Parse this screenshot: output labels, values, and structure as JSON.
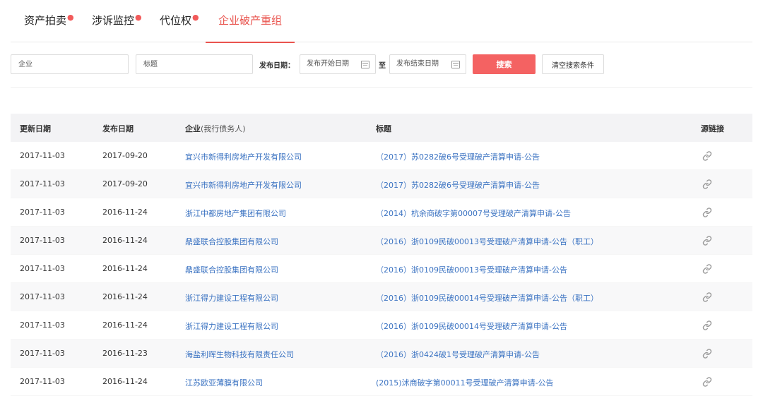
{
  "tabs": [
    {
      "label": "资产拍卖",
      "dot": "●"
    },
    {
      "label": "涉诉监控",
      "dot": "●"
    },
    {
      "label": "代位权",
      "dot": "●"
    },
    {
      "label": "企业破产重组",
      "dot": ""
    }
  ],
  "filters": {
    "company_placeholder": "企业",
    "title_placeholder": "标题",
    "date_label": "发布日期：",
    "start_placeholder": "发布开始日期",
    "to_label": "至",
    "end_placeholder": "发布结束日期",
    "search_label": "搜索",
    "clear_label": "清空搜索条件"
  },
  "table": {
    "headers": {
      "update_date": "更新日期",
      "publish_date": "发布日期",
      "company": "企业",
      "company_sub": "(我行债务人)",
      "title": "标题",
      "source": "源链接"
    },
    "rows": [
      {
        "update": "2017-11-03",
        "publish": "2017-09-20",
        "company": "宜兴市新得利房地产开发有限公司",
        "title": "（2017）苏0282破6号受理破产清算申请-公告",
        "icon": "link-icon"
      },
      {
        "update": "2017-11-03",
        "publish": "2017-09-20",
        "company": "宜兴市新得利房地产开发有限公司",
        "title": "（2017）苏0282破6号受理破产清算申请-公告",
        "icon": "link-icon"
      },
      {
        "update": "2017-11-03",
        "publish": "2016-11-24",
        "company": "浙江中都房地产集团有限公司",
        "title": "（2014）杭余商破字第00007号受理破产清算申请-公告",
        "icon": "link-icon"
      },
      {
        "update": "2017-11-03",
        "publish": "2016-11-24",
        "company": "鼎盛联合控股集团有限公司",
        "title": "（2016）浙0109民破00013号受理破产清算申请-公告（职工）",
        "icon": "link-icon"
      },
      {
        "update": "2017-11-03",
        "publish": "2016-11-24",
        "company": "鼎盛联合控股集团有限公司",
        "title": "（2016）浙0109民破00013号受理破产清算申请-公告",
        "icon": "link-icon"
      },
      {
        "update": "2017-11-03",
        "publish": "2016-11-24",
        "company": "浙江得力建设工程有限公司",
        "title": "（2016）浙0109民破00014号受理破产清算申请-公告（职工）",
        "icon": "link-icon"
      },
      {
        "update": "2017-11-03",
        "publish": "2016-11-24",
        "company": "浙江得力建设工程有限公司",
        "title": "（2016）浙0109民破00014号受理破产清算申请-公告",
        "icon": "link-icon"
      },
      {
        "update": "2017-11-03",
        "publish": "2016-11-23",
        "company": "海盐利晖生物科技有限责任公司",
        "title": "（2016）浙0424破1号受理破产清算申请-公告",
        "icon": "link-icon"
      },
      {
        "update": "2017-11-03",
        "publish": "2016-11-24",
        "company": "江苏欧亚薄膜有限公司",
        "title": "(2015)沭商破字第00011号受理破产清算申请-公告",
        "icon": "link-icon"
      }
    ]
  },
  "colors": {
    "accent": "#e9544e",
    "search_button": "#f46262",
    "link": "#3b73c2",
    "header_bg": "#f3f3f5"
  }
}
